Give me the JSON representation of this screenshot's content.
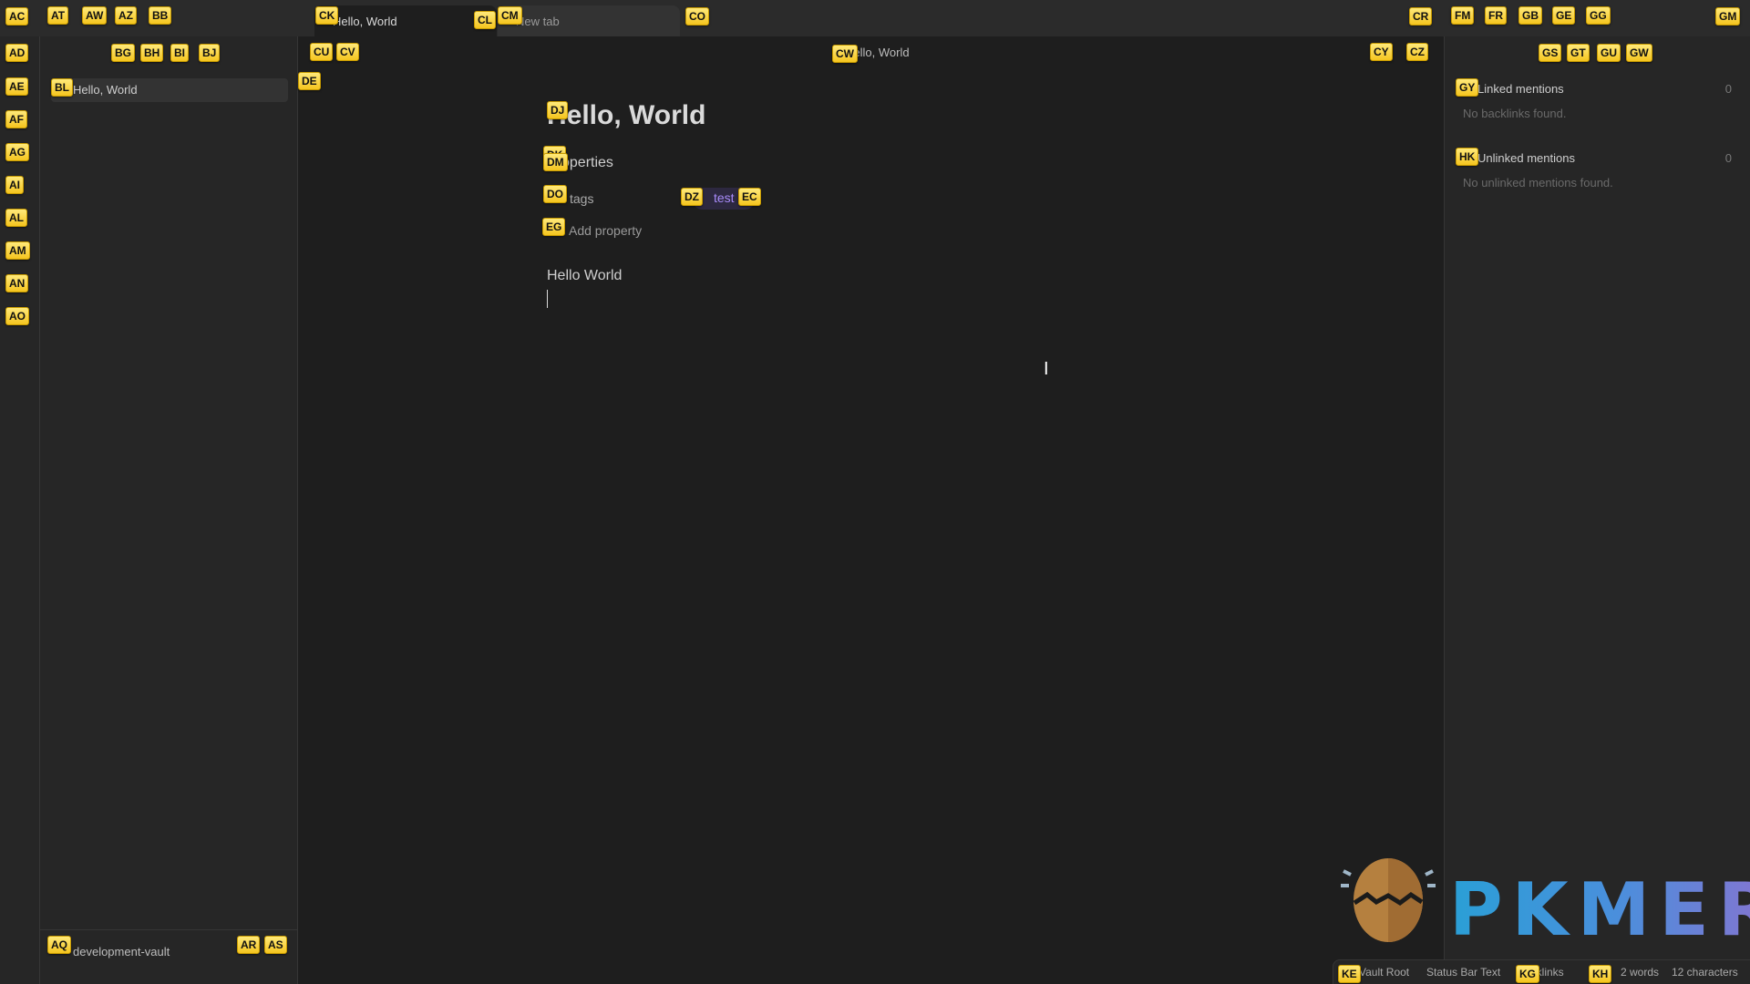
{
  "tabs": [
    {
      "label": "Hello, World",
      "active": true
    },
    {
      "label": "New tab",
      "active": false
    }
  ],
  "left_sidebar": {
    "files": [
      {
        "label": "Hello, World",
        "selected": true
      }
    ],
    "vault_name": "development-vault"
  },
  "view_header": {
    "title": "Hello, World"
  },
  "note": {
    "title": "Hello, World",
    "properties_heading": "Properties",
    "properties": [
      {
        "key": "tags",
        "values": [
          "test"
        ]
      }
    ],
    "add_property_label": "Add property",
    "body": "Hello World"
  },
  "right_sidebar": {
    "linked": {
      "label": "Linked mentions",
      "count": "0",
      "empty": "No backlinks found."
    },
    "unlinked": {
      "label": "Unlinked mentions",
      "count": "0",
      "empty": "No unlinked mentions found."
    }
  },
  "status_bar": {
    "vault_root": "Vault Root",
    "custom_text": "Status Bar Text",
    "backlinks": "Backlinks",
    "word_count": "2 words",
    "char_count": "12 characters"
  },
  "watermark": {
    "text": "PKMER"
  },
  "hints": {
    "AC": "AC",
    "AT": "AT",
    "AW": "AW",
    "AZ": "AZ",
    "BB": "BB",
    "CK": "CK",
    "CL": "CL",
    "CM": "CM",
    "CO": "CO",
    "CR": "CR",
    "FM": "FM",
    "FR": "FR",
    "GB": "GB",
    "GE": "GE",
    "GG": "GG",
    "GM": "GM",
    "AD": "AD",
    "AE": "AE",
    "AF": "AF",
    "AG": "AG",
    "AI": "AI",
    "AL": "AL",
    "AM": "AM",
    "AN": "AN",
    "AO": "AO",
    "BG": "BG",
    "BH": "BH",
    "BI": "BI",
    "BJ": "BJ",
    "BL": "BL",
    "AQ": "AQ",
    "AR": "AR",
    "AS": "AS",
    "CU": "CU",
    "CV": "CV",
    "DE": "DE",
    "CW": "CW",
    "CY": "CY",
    "CZ": "CZ",
    "DJ": "DJ",
    "DK": "DK",
    "DM": "DM",
    "DO": "DO",
    "DZ": "DZ",
    "EC": "EC",
    "EG": "EG",
    "GS": "GS",
    "GT": "GT",
    "GU": "GU",
    "GW": "GW",
    "GY": "GY",
    "HK": "HK",
    "KE": "KE",
    "KG": "KG",
    "KH": "KH"
  }
}
